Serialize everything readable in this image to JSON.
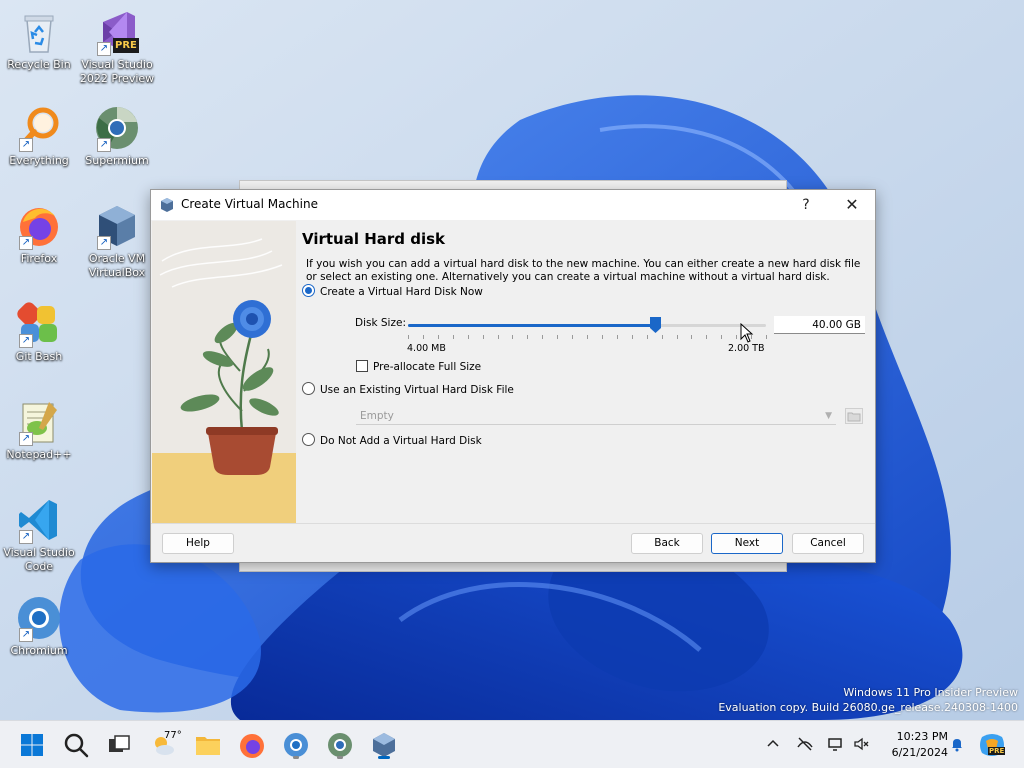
{
  "desktop": {
    "icons": [
      {
        "label_1": "Recycle Bin",
        "label_2": "",
        "icon": "recycle-bin-icon"
      },
      {
        "label_1": "Visual Studio",
        "label_2": "2022 Preview",
        "icon": "visual-studio-preview-icon",
        "badge": "PRE"
      },
      {
        "label_1": "Everything",
        "label_2": "",
        "icon": "everything-search-icon"
      },
      {
        "label_1": "Supermium",
        "label_2": "",
        "icon": "supermium-icon"
      },
      {
        "label_1": "Firefox",
        "label_2": "",
        "icon": "firefox-icon"
      },
      {
        "label_1": "Oracle VM",
        "label_2": "VirtualBox",
        "icon": "virtualbox-icon"
      },
      {
        "label_1": "Git Bash",
        "label_2": "",
        "icon": "git-bash-icon"
      },
      {
        "label_1": "Notepad++",
        "label_2": "",
        "icon": "notepadpp-icon"
      },
      {
        "label_1": "Visual Studio",
        "label_2": "Code",
        "icon": "vscode-icon"
      },
      {
        "label_1": "Chromium",
        "label_2": "",
        "icon": "chromium-icon"
      }
    ]
  },
  "dialog": {
    "title": "Create Virtual Machine",
    "help_glyph": "?",
    "close_glyph": "✕",
    "heading": "Virtual Hard disk",
    "description": "If you wish you can add a virtual hard disk to the new machine. You can either create a new hard disk file or select an existing one. Alternatively you can create a virtual machine without a virtual hard disk.",
    "options": {
      "create_now": "Create a Virtual Hard Disk Now",
      "use_existing": "Use an Existing Virtual Hard Disk File",
      "no_disk": "Do Not Add a Virtual Hard Disk"
    },
    "selected_option": "create_now",
    "disk_size_label": "Disk Size:",
    "disk_size_value": "40.00 GB",
    "slider_min_label": "4.00 MB",
    "slider_max_label": "2.00 TB",
    "slider_position": 0.69,
    "preallocate_label": "Pre-allocate Full Size",
    "preallocate_checked": false,
    "existing_disk_value": "Empty",
    "buttons": {
      "help": "Help",
      "back": "Back",
      "next": "Next",
      "cancel": "Cancel"
    }
  },
  "watermark": {
    "line1": "Windows 11 Pro Insider Preview",
    "line2": "Evaluation copy. Build 26080.ge_release.240308-1400"
  },
  "taskbar": {
    "weather_temp": "77°",
    "time": "10:23 PM",
    "date": "6/21/2024",
    "copilot_badge": "PRE"
  },
  "colors": {
    "accent": "#1a67c8",
    "taskbar_bg": "#eef0f4",
    "illustration_sand": "#f0cf7c"
  }
}
